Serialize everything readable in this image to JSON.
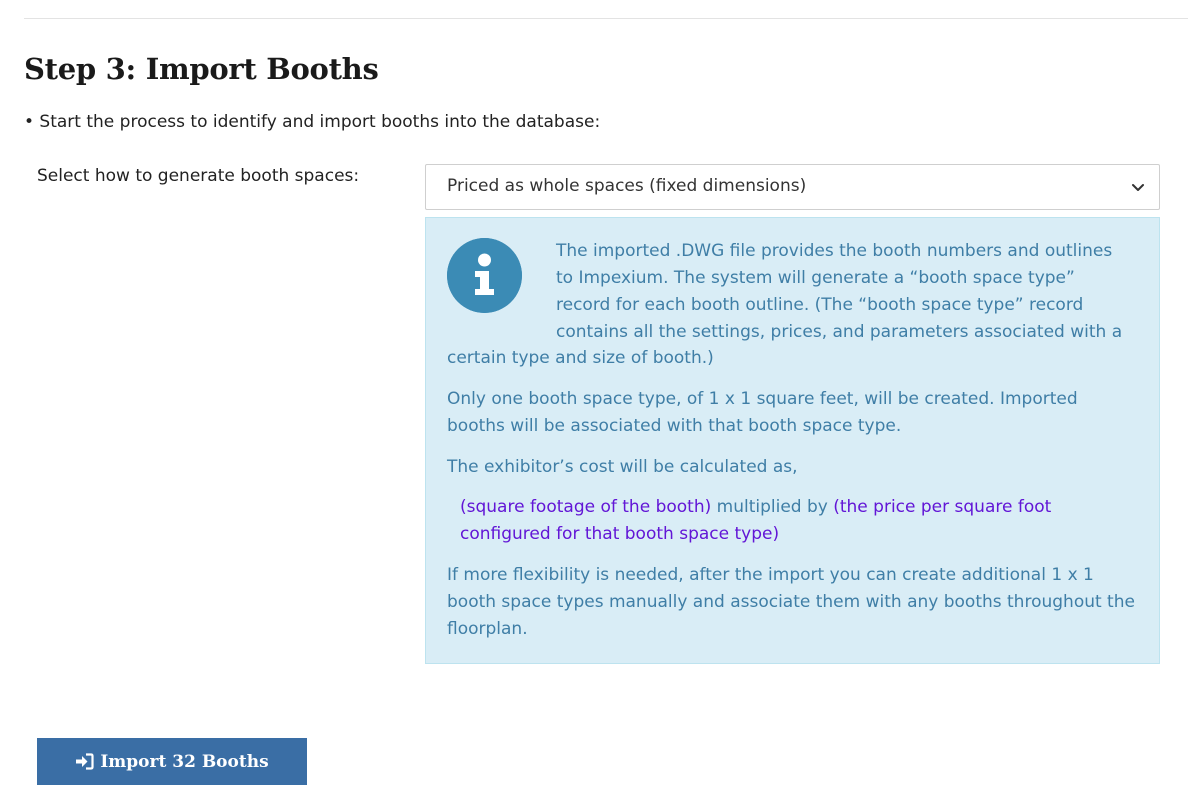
{
  "step": {
    "title": "Step 3: Import Booths",
    "bullet": "• Start the process to identify and import booths into the database:"
  },
  "generation": {
    "label": "Select how to generate booth spaces:",
    "selected": "Priced as whole spaces (fixed dimensions)"
  },
  "info": {
    "icon": "info-icon",
    "p1_lines": [
      "The imported .DWG file provides the booth numbers and outlines",
      "to Impexium. The system will generate a “booth space type”",
      "record for each booth outline. (The “booth space type” record",
      "contains all the settings, prices, and parameters associated with a"
    ],
    "p1_tail": "certain type and size of booth.)",
    "p2": "Only one booth space type, of 1 x 1 square feet, will be created. Imported booths will be associated with that booth space type.",
    "p3": "The exhibitor’s cost will be calculated as,",
    "formula": {
      "part1": "(square footage of the booth)",
      "connector": " multiplied by ",
      "part2": "(the price per square foot configured for that booth space type)"
    },
    "p4": "If more flexibility is needed, after the import you can create additional 1 x 1 booth space types manually and associate them with any booths throughout the floorplan."
  },
  "actions": {
    "import_label": "Import 32 Booths",
    "import_icon": "sign-in-icon"
  },
  "colors": {
    "info_bg": "#d9edf6",
    "info_text": "#3f7ea6",
    "formula_text": "#6216d6",
    "button_bg": "#3a6ea5"
  }
}
